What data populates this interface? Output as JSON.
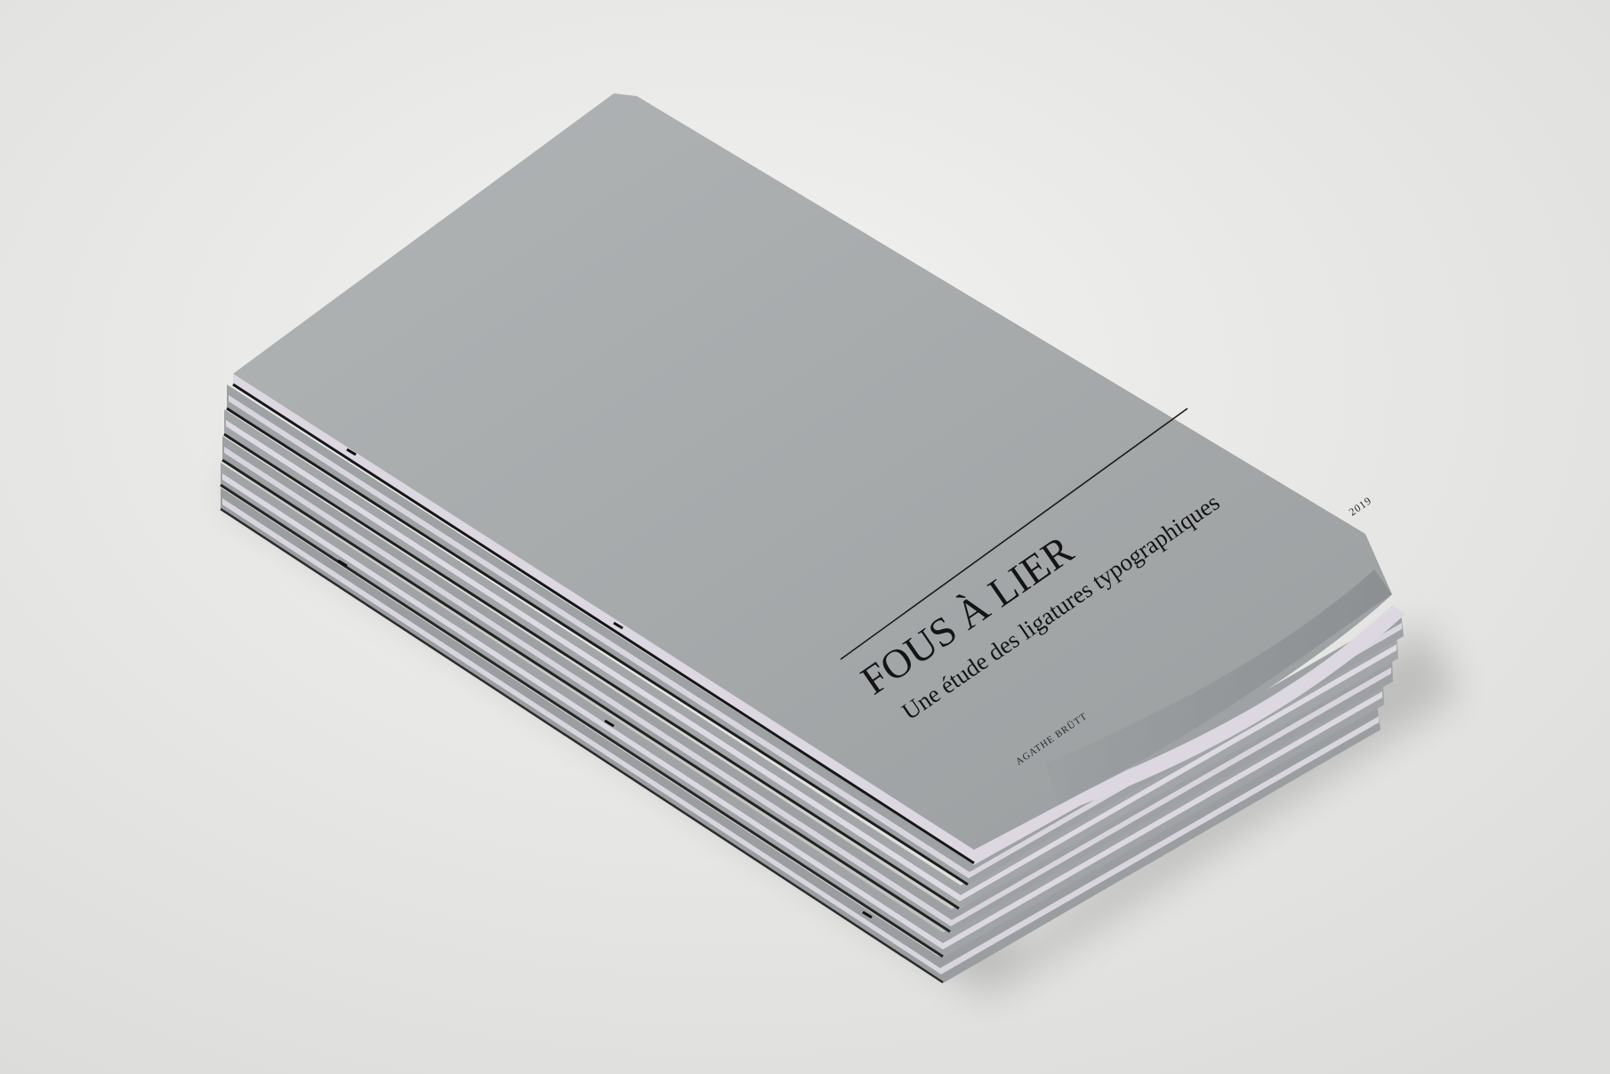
{
  "booklet": {
    "title": "FOUS À LIER",
    "subtitle": "Une étude des ligatures typographiques",
    "author": "AGATHE BRÜTT",
    "year": "2019",
    "stack_count": 6
  },
  "colors": {
    "background": "#e9e9e7",
    "cover": "#a6aaab",
    "cover_dark": "#8e9294",
    "pages": "#d9d5de",
    "ink": "#141414"
  }
}
